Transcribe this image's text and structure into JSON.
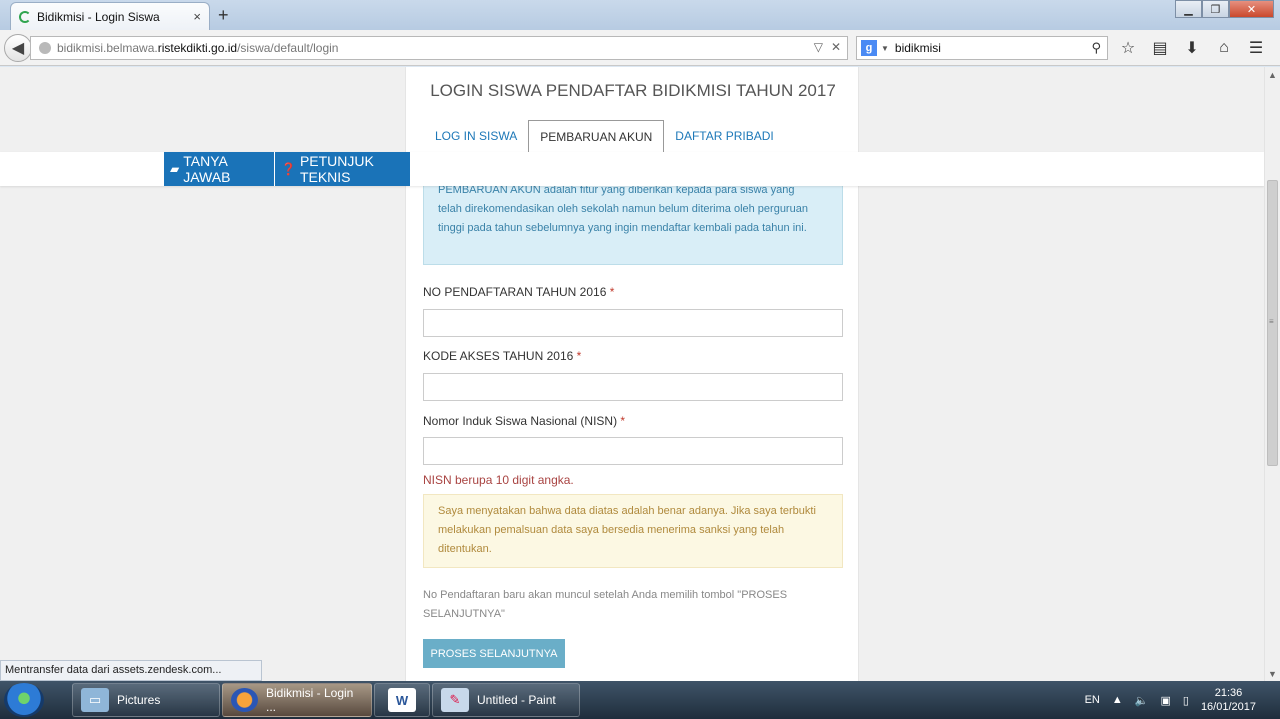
{
  "browser": {
    "tab_title": "Bidikmisi - Login Siswa",
    "tab_close": "×",
    "new_tab": "+",
    "url_prefix": "bidikmisi.belmawa.",
    "url_domain": "ristekdikti.go.id",
    "url_path": "/siswa/default/login",
    "search_value": "bidikmisi",
    "search_engine_letter": "g",
    "window_buttons": {
      "minimize": "▁",
      "maximize": "❐",
      "close": "✕"
    },
    "toolbar_icons": [
      "star-icon",
      "reading-list-icon",
      "download-icon",
      "home-icon",
      "menu-icon"
    ]
  },
  "page": {
    "title": "LOGIN SISWA PENDAFTAR BIDIKMISI TAHUN 2017",
    "tabs": [
      {
        "label": "LOG IN SISWA",
        "active": false
      },
      {
        "label": "PEMBARUAN AKUN",
        "active": true
      },
      {
        "label": "DAFTAR PRIBADI",
        "active": false
      }
    ],
    "info_text": "PEMBARUAN AKUN adalah fitur yang diberikan kepada para siswa yang telah direkomendasikan oleh sekolah namun belum diterima oleh perguruan tinggi pada tahun sebelumnya yang ingin mendaftar kembali pada tahun ini.",
    "fields": [
      {
        "label": "NO PENDAFTARAN TAHUN 2016",
        "required": "*",
        "value": ""
      },
      {
        "label": "KODE AKSES TAHUN 2016",
        "required": "*",
        "value": ""
      },
      {
        "label": "Nomor Induk Siswa Nasional (NISN)",
        "required": "*",
        "value": ""
      }
    ],
    "nisn_hint": "NISN berupa 10 digit angka.",
    "warning_text": "Saya menyatakan bahwa data diatas adalah benar adanya. Jika saya terbukti melakukan pemalsuan data saya bersedia menerima sanksi yang telah ditentukan.",
    "note_text": "No Pendaftaran baru akan muncul setelah Anda memilih tombol \"PROSES SELANJUTNYA\"",
    "submit_label": "PROSES SELANJUTNYA"
  },
  "floating": {
    "faq_label": "TANYA JAWAB",
    "guide_label": "PETUNJUK TEKNIS"
  },
  "status_bar": "Mentransfer data dari assets.zendesk.com...",
  "taskbar": {
    "items": [
      {
        "label": "Pictures",
        "icon": "pictures-icon"
      },
      {
        "label": "Bidikmisi - Login ...",
        "icon": "firefox-icon"
      },
      {
        "label": "",
        "icon": "word-icon"
      },
      {
        "label": "Untitled - Paint",
        "icon": "paint-icon"
      }
    ],
    "language": "EN",
    "time": "21:36",
    "date": "16/01/2017"
  },
  "colors": {
    "accent": "#1a73b8",
    "link": "#1d78b8",
    "button": "#6aaec8",
    "info_bg": "#d9eef7",
    "warning_bg": "#fcf8e3"
  }
}
